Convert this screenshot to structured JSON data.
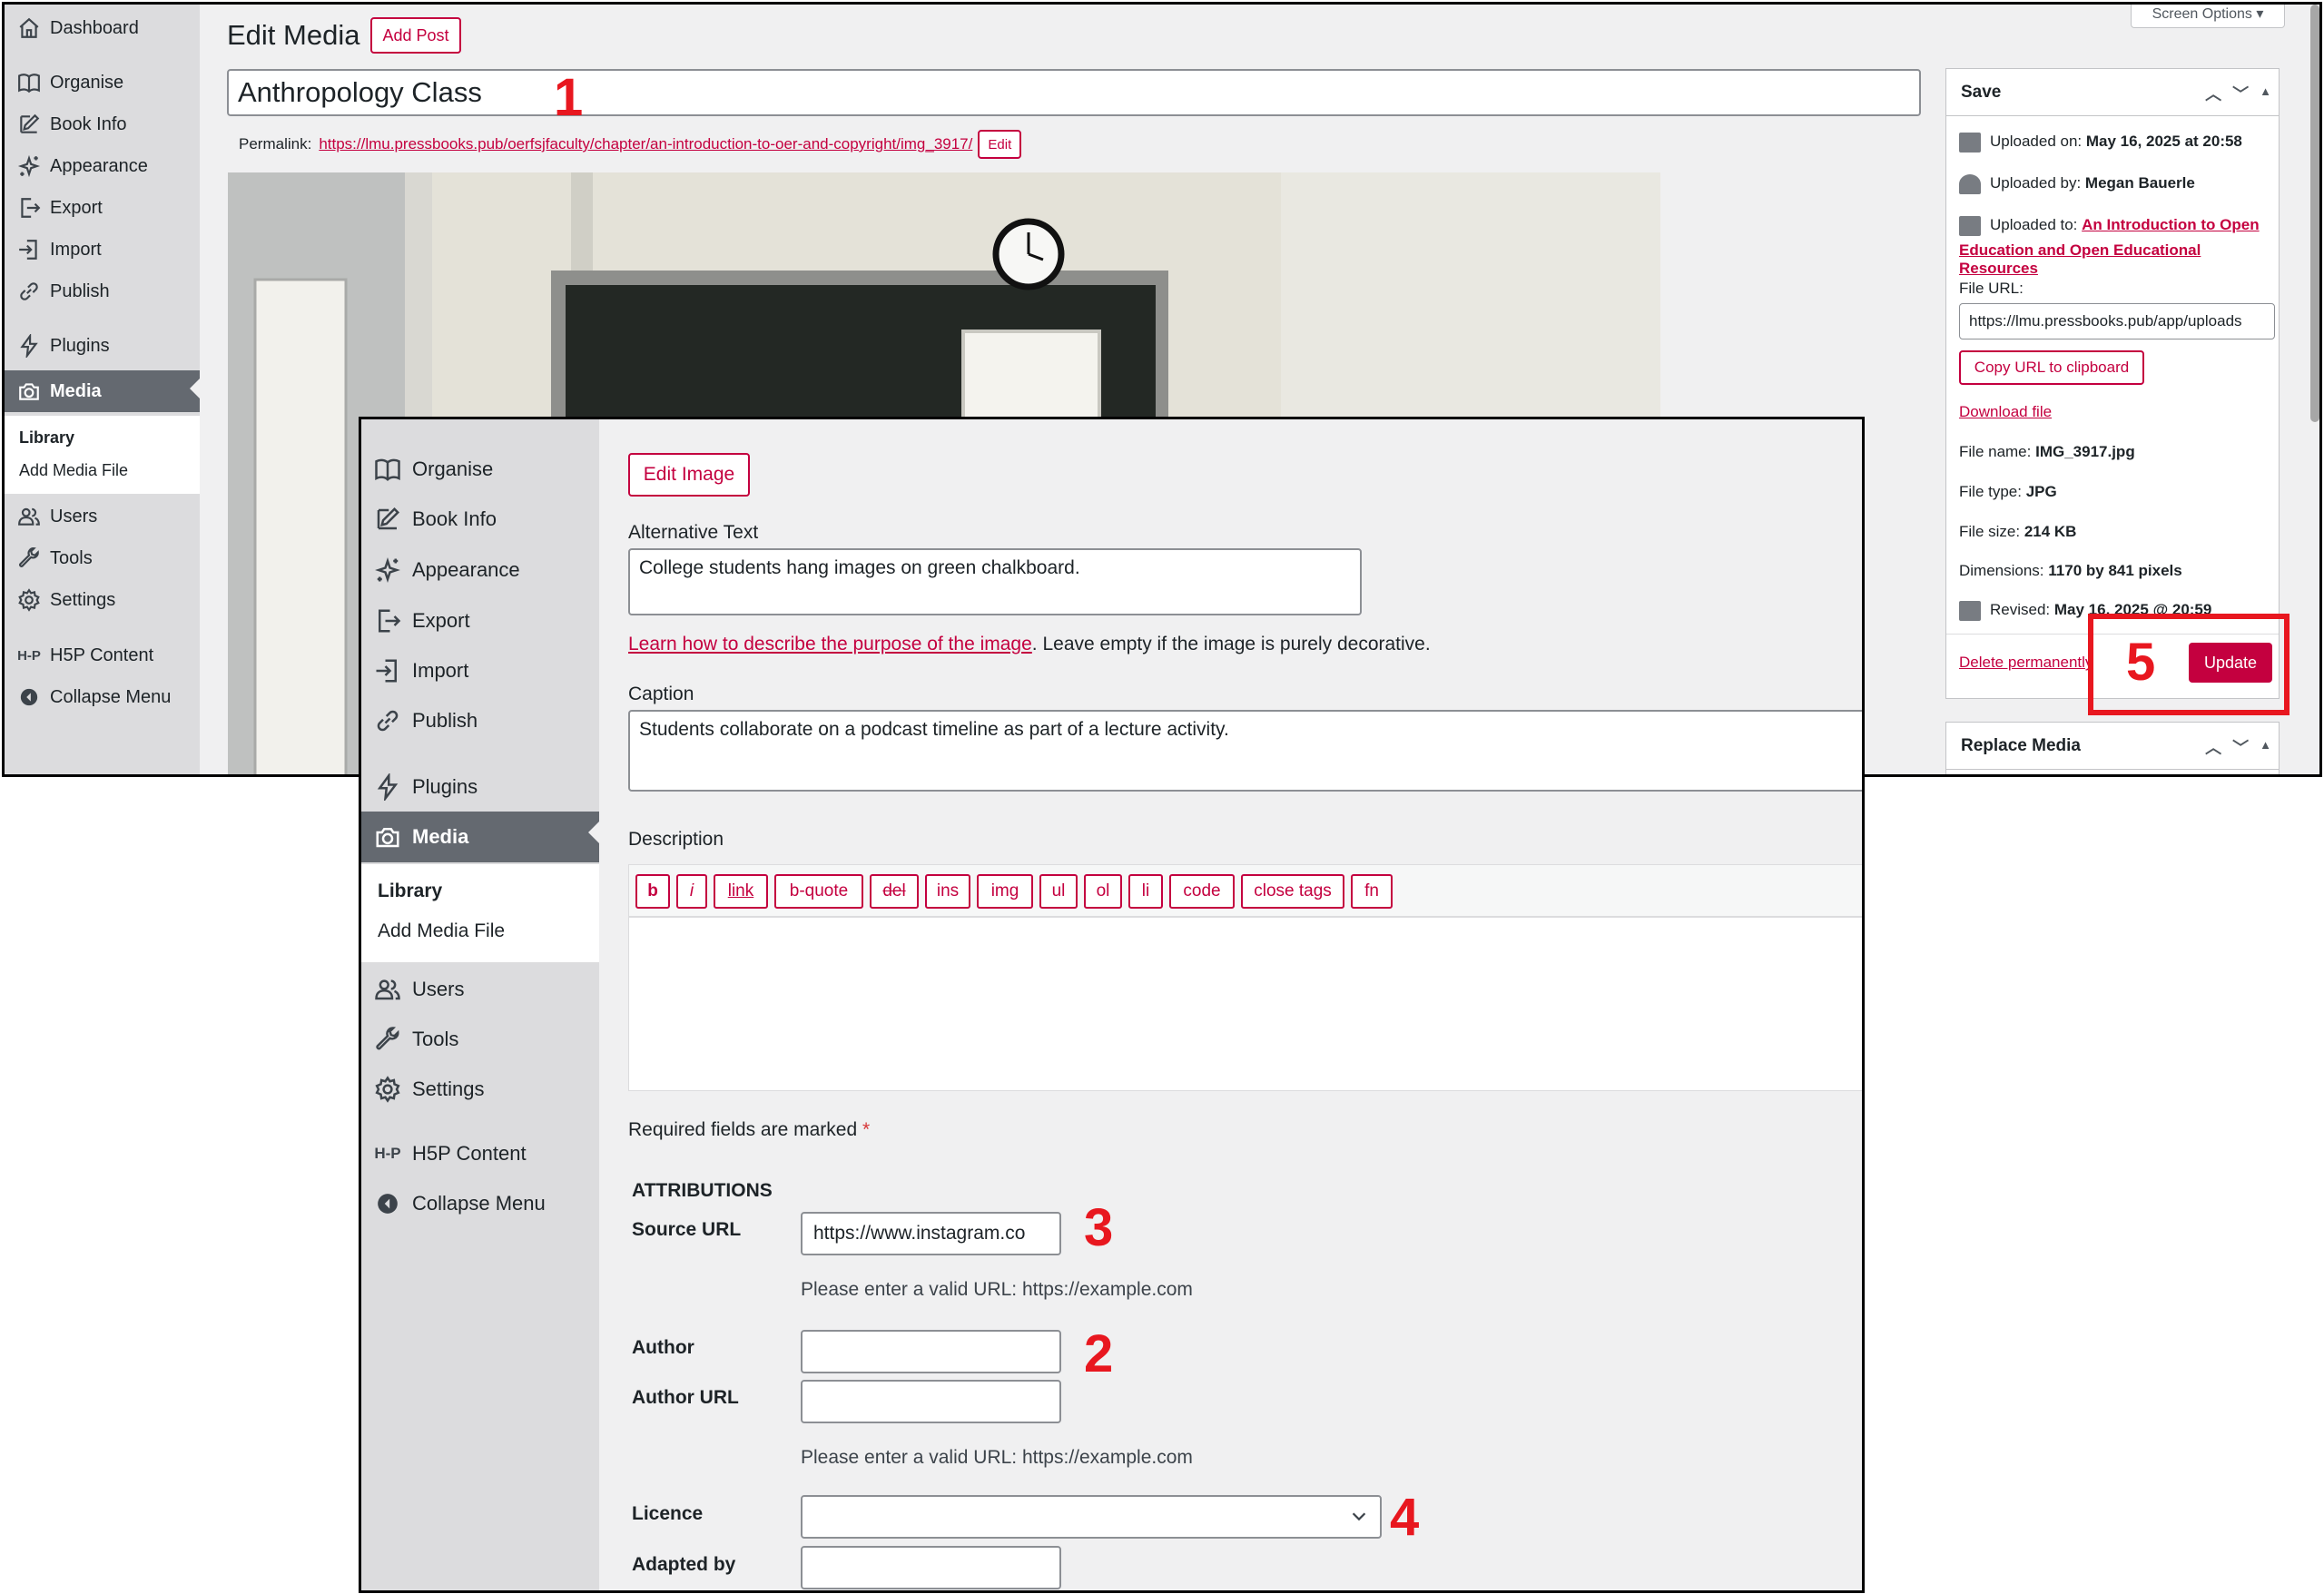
{
  "back": {
    "sidebar": {
      "items": [
        {
          "label": "Dashboard",
          "icon": "home-icon"
        },
        {
          "label": "Organise",
          "icon": "book-icon"
        },
        {
          "label": "Book Info",
          "icon": "edit-icon"
        },
        {
          "label": "Appearance",
          "icon": "sparkle-icon"
        },
        {
          "label": "Export",
          "icon": "export-icon"
        },
        {
          "label": "Import",
          "icon": "import-icon"
        },
        {
          "label": "Publish",
          "icon": "link-icon"
        },
        {
          "label": "Plugins",
          "icon": "plugin-icon"
        },
        {
          "label": "Media",
          "icon": "camera-icon"
        },
        {
          "label": "Users",
          "icon": "users-icon"
        },
        {
          "label": "Tools",
          "icon": "wrench-icon"
        },
        {
          "label": "Settings",
          "icon": "gear-icon"
        },
        {
          "label": "H5P Content",
          "icon": "h5p-icon"
        },
        {
          "label": "Collapse Menu",
          "icon": "collapse-icon"
        }
      ],
      "submenu": [
        "Library",
        "Add Media File"
      ]
    },
    "page_title": "Edit Media",
    "add_post": "Add Post",
    "screen_options": "Screen Options ▾",
    "title_value": "Anthropology Class",
    "permalink_label": "Permalink:",
    "permalink_url": "https://lmu.pressbooks.pub/oerfsjfaculty/chapter/an-introduction-to-oer-and-copyright/img_3917/",
    "permalink_edit": "Edit",
    "save_box": {
      "title": "Save",
      "uploaded_on_label": "Uploaded on:",
      "uploaded_on": "May 16, 2025 at 20:58",
      "uploaded_by_label": "Uploaded by:",
      "uploaded_by": "Megan Bauerle",
      "uploaded_to_label": "Uploaded to:",
      "uploaded_to_1": "An Introduction to Open",
      "uploaded_to_2": "Education and Open Educational Resources",
      "file_url_label": "File URL:",
      "file_url": "https://lmu.pressbooks.pub/app/uploads",
      "copy_url": "Copy URL to clipboard",
      "download": "Download file",
      "file_name_label": "File name:",
      "file_name": "IMG_3917.jpg",
      "file_type_label": "File type:",
      "file_type": "JPG",
      "file_size_label": "File size:",
      "file_size": "214 KB",
      "dimensions_label": "Dimensions:",
      "dimensions": "1170 by 841 pixels",
      "revised_label": "Revised:",
      "revised": "May 16, 2025 @ 20:59",
      "delete": "Delete permanently",
      "update": "Update"
    },
    "replace_box": {
      "title": "Replace Media"
    }
  },
  "front": {
    "sidebar": {
      "items": [
        {
          "label": "Organise",
          "icon": "book-icon"
        },
        {
          "label": "Book Info",
          "icon": "edit-icon"
        },
        {
          "label": "Appearance",
          "icon": "sparkle-icon"
        },
        {
          "label": "Export",
          "icon": "export-icon"
        },
        {
          "label": "Import",
          "icon": "import-icon"
        },
        {
          "label": "Publish",
          "icon": "link-icon"
        },
        {
          "label": "Plugins",
          "icon": "plugin-icon"
        },
        {
          "label": "Media",
          "icon": "camera-icon"
        },
        {
          "label": "Users",
          "icon": "users-icon"
        },
        {
          "label": "Tools",
          "icon": "wrench-icon"
        },
        {
          "label": "Settings",
          "icon": "gear-icon"
        },
        {
          "label": "H5P Content",
          "icon": "h5p-icon"
        },
        {
          "label": "Collapse Menu",
          "icon": "collapse-icon"
        }
      ],
      "submenu": [
        "Library",
        "Add Media File"
      ]
    },
    "edit_image": "Edit Image",
    "alt_label": "Alternative Text",
    "alt_value": "College students hang images on green chalkboard.",
    "alt_help_link": "Learn how to describe the purpose of the image",
    "alt_help_rest": ". Leave empty if the image is purely decorative.",
    "caption_label": "Caption",
    "caption_value": "Students collaborate on a podcast timeline as part of a lecture activity.",
    "description_label": "Description",
    "quicktags": [
      "b",
      "i",
      "link",
      "b-quote",
      "del",
      "ins",
      "img",
      "ul",
      "ol",
      "li",
      "code",
      "close tags",
      "fn"
    ],
    "required_text": "Required fields are marked",
    "required_star": "*",
    "attributions": "ATTRIBUTIONS",
    "source_url_label": "Source URL",
    "source_url_value": "https://www.instagram.co",
    "url_help": "Please enter a valid URL: https://example.com",
    "author_label": "Author",
    "author_value": "",
    "author_url_label": "Author URL",
    "author_url_value": "",
    "licence_label": "Licence",
    "licence_value": "",
    "adapted_label": "Adapted by",
    "adapted_value": ""
  },
  "annotations": [
    "1",
    "2",
    "3",
    "4",
    "5"
  ],
  "colors": {
    "accent": "#c4003f",
    "annotation": "#e8171f",
    "sidebar": "#dcdcde",
    "active": "#646970"
  }
}
